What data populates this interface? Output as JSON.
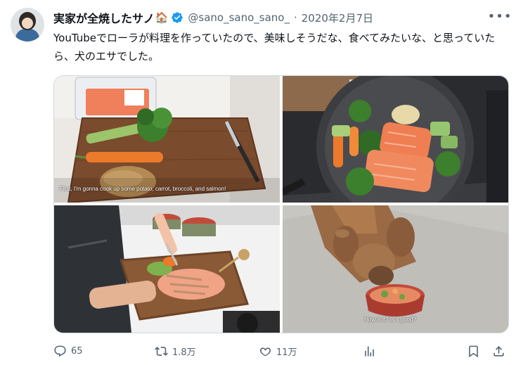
{
  "tweet": {
    "author_name": "実家が全焼したサノ",
    "author_emoji": "🏠",
    "handle": "@sano_sano_sano_",
    "separator": "·",
    "date": "2020年2月7日",
    "more_label": "•••",
    "text": "YouTubeでローラが料理を作っていたので、美味しそうだな、食べてみたいな、と思っていたら、犬のエサでした。"
  },
  "media": {
    "captions": [
      "First, I'm gonna cook up some potato, carrot, broccoli, and salmon!",
      "How is it? Is it good?"
    ]
  },
  "actions": {
    "replies": "65",
    "retweets": "1.8万",
    "likes": "11万"
  },
  "colors": {
    "verified_badge": "#1d9bf0",
    "secondary_text": "#536471"
  },
  "icons": [
    "reply-icon",
    "retweet-icon",
    "like-icon",
    "views-icon",
    "bookmark-icon",
    "share-icon",
    "more-icon",
    "verified-icon"
  ]
}
